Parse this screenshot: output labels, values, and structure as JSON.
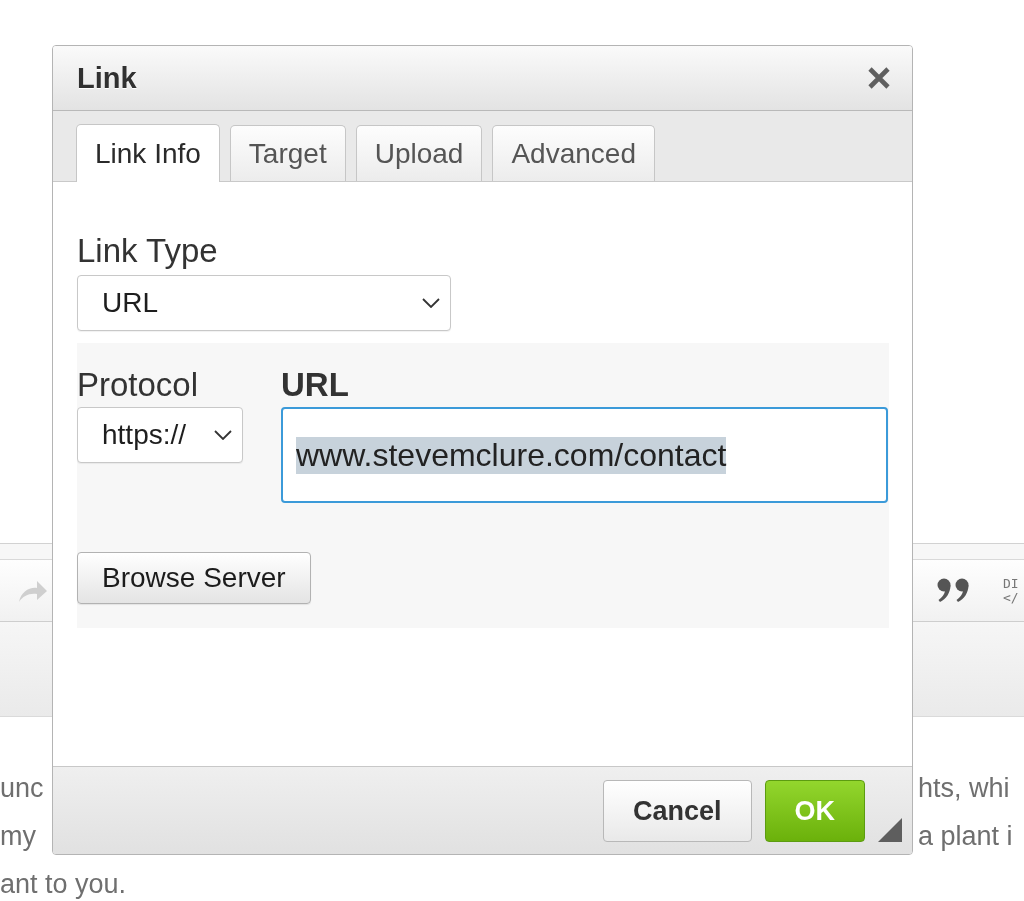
{
  "dialog": {
    "title": "Link",
    "tabs": [
      {
        "label": "Link Info",
        "selected": true
      },
      {
        "label": "Target",
        "selected": false
      },
      {
        "label": "Upload",
        "selected": false
      },
      {
        "label": "Advanced",
        "selected": false
      }
    ],
    "link_type": {
      "label": "Link Type",
      "value": "URL",
      "required": false
    },
    "protocol": {
      "label": "Protocol",
      "value": "https://",
      "required": false
    },
    "url": {
      "label": "URL",
      "value": "www.stevemclure.com/contact",
      "required": true,
      "focused": true,
      "text_selected": true
    },
    "browse_button": "Browse Server",
    "buttons": [
      {
        "label": "Cancel",
        "kind": "secondary"
      },
      {
        "label": "OK",
        "kind": "primary"
      }
    ]
  },
  "editor": {
    "toolbar_left": [
      {
        "kind": "redo",
        "disabled": true
      }
    ],
    "toolbar_right": [
      {
        "kind": "blockquote",
        "disabled": false
      },
      {
        "kind": "glyph",
        "top": "DI",
        "bottom": "</",
        "disabled": false
      }
    ],
    "text_lines": [
      {
        "left": "unc",
        "right": "hts, whi"
      },
      {
        "left": "my",
        "right": "a plant i"
      },
      {
        "left": "ant to you."
      }
    ]
  }
}
